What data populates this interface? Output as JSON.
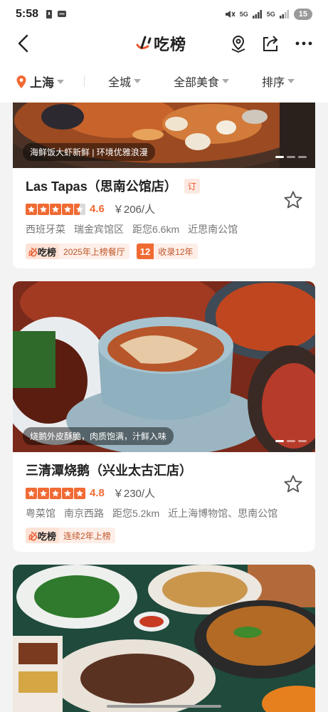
{
  "status_bar": {
    "time": "5:58",
    "signal_1": "5G",
    "signal_2": "5G",
    "battery": "15"
  },
  "header": {
    "logo_mark": "必",
    "logo_word": "吃榜"
  },
  "filters": {
    "city": "上海",
    "area": "全城",
    "category": "全部美食",
    "sort": "排序"
  },
  "restaurants": [
    {
      "photo_caption": "海鲜饭大虾新鲜 | 环境优雅浪漫",
      "name": "Las Tapas（思南公馆店）",
      "booking_tag": "订",
      "score": "4.6",
      "price": "￥206/人",
      "cuisine": "西班牙菜",
      "area": "瑞金宾馆区",
      "distance": "距您6.6km",
      "landmark": "近思南公馆",
      "rank_text": "2025年上榜餐厅",
      "years_num": "12",
      "years_text": "收录12年",
      "stars_rating": 4.5
    },
    {
      "photo_caption": "烧鹅外皮酥脆，肉质饱满，汁鲜入味",
      "name": "三清潭烧鹅（兴业太古汇店）",
      "score": "4.8",
      "price": "￥230/人",
      "cuisine": "粤菜馆",
      "area": "南京西路",
      "distance": "距您5.2km",
      "landmark": "近上海博物馆、思南公馆",
      "rank_text": "连续2年上榜",
      "stars_rating": 5
    }
  ],
  "icons": {
    "back": "back-arrow-icon",
    "location": "location-pin-icon",
    "share": "share-icon",
    "more": "more-icon",
    "favorite": "star-outline-icon"
  },
  "colors": {
    "brand": "#e8562a",
    "rating": "#f06a33"
  }
}
